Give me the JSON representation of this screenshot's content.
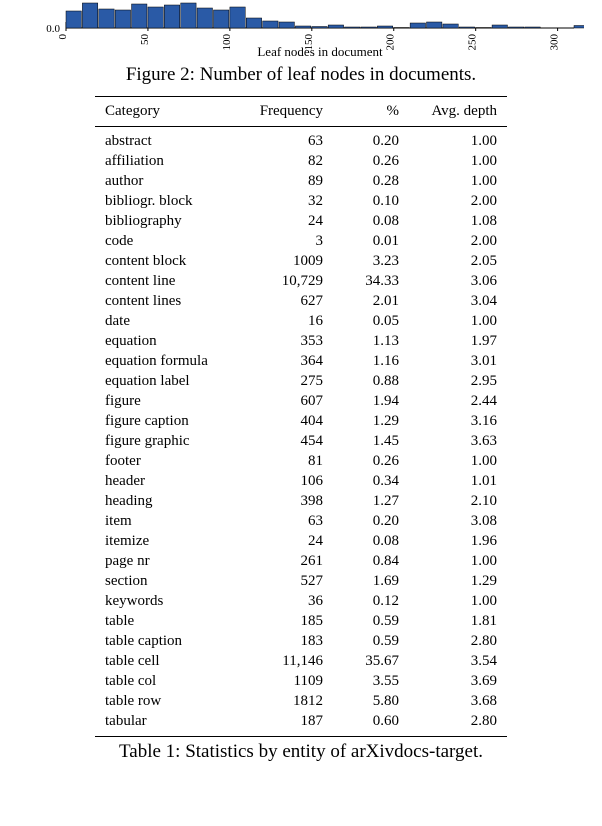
{
  "chart_data": {
    "type": "bar",
    "title": "",
    "xlabel": "Leaf nodes in document",
    "ylabel": "",
    "xlim": [
      0,
      310
    ],
    "ylim": [
      0.0,
      2.8
    ],
    "xticks": [
      0,
      50,
      100,
      150,
      200,
      250,
      300
    ],
    "yticks_visible": [
      0.0
    ],
    "bin_width": 10,
    "categories": [
      0,
      10,
      20,
      30,
      40,
      50,
      60,
      70,
      80,
      90,
      100,
      110,
      120,
      130,
      140,
      150,
      160,
      170,
      180,
      190,
      200,
      210,
      220,
      230,
      240,
      250,
      260,
      270,
      280,
      290,
      300,
      310
    ],
    "values": [
      1.7,
      2.5,
      1.9,
      1.8,
      2.4,
      2.1,
      2.3,
      2.5,
      2.0,
      1.8,
      2.1,
      1.0,
      0.7,
      0.6,
      0.2,
      0.15,
      0.3,
      0.1,
      0.1,
      0.2,
      0.05,
      0.5,
      0.6,
      0.4,
      0.1,
      0.05,
      0.3,
      0.1,
      0.1,
      0.0,
      0.0,
      0.25
    ],
    "bar_color": "#2a5aa6"
  },
  "figure_caption": "Figure 2: Number of leaf nodes in documents.",
  "table_caption": "Table 1: Statistics by entity of arXivdocs-target.",
  "table": {
    "headers": {
      "c0": "Category",
      "c1": "Frequency",
      "c2": "%",
      "c3": "Avg. depth"
    },
    "rows": [
      {
        "cat": "abstract",
        "freq": "63",
        "pct": "0.20",
        "dep": "1.00"
      },
      {
        "cat": "affiliation",
        "freq": "82",
        "pct": "0.26",
        "dep": "1.00"
      },
      {
        "cat": "author",
        "freq": "89",
        "pct": "0.28",
        "dep": "1.00"
      },
      {
        "cat": "bibliogr. block",
        "freq": "32",
        "pct": "0.10",
        "dep": "2.00"
      },
      {
        "cat": "bibliography",
        "freq": "24",
        "pct": "0.08",
        "dep": "1.08"
      },
      {
        "cat": "code",
        "freq": "3",
        "pct": "0.01",
        "dep": "2.00"
      },
      {
        "cat": "content block",
        "freq": "1009",
        "pct": "3.23",
        "dep": "2.05"
      },
      {
        "cat": "content line",
        "freq": "10,729",
        "pct": "34.33",
        "dep": "3.06"
      },
      {
        "cat": "content lines",
        "freq": "627",
        "pct": "2.01",
        "dep": "3.04"
      },
      {
        "cat": "date",
        "freq": "16",
        "pct": "0.05",
        "dep": "1.00"
      },
      {
        "cat": "equation",
        "freq": "353",
        "pct": "1.13",
        "dep": "1.97"
      },
      {
        "cat": "equation formula",
        "freq": "364",
        "pct": "1.16",
        "dep": "3.01"
      },
      {
        "cat": "equation label",
        "freq": "275",
        "pct": "0.88",
        "dep": "2.95"
      },
      {
        "cat": "figure",
        "freq": "607",
        "pct": "1.94",
        "dep": "2.44"
      },
      {
        "cat": "figure caption",
        "freq": "404",
        "pct": "1.29",
        "dep": "3.16"
      },
      {
        "cat": "figure graphic",
        "freq": "454",
        "pct": "1.45",
        "dep": "3.63"
      },
      {
        "cat": "footer",
        "freq": "81",
        "pct": "0.26",
        "dep": "1.00"
      },
      {
        "cat": "header",
        "freq": "106",
        "pct": "0.34",
        "dep": "1.01"
      },
      {
        "cat": "heading",
        "freq": "398",
        "pct": "1.27",
        "dep": "2.10"
      },
      {
        "cat": "item",
        "freq": "63",
        "pct": "0.20",
        "dep": "3.08"
      },
      {
        "cat": "itemize",
        "freq": "24",
        "pct": "0.08",
        "dep": "1.96"
      },
      {
        "cat": "page nr",
        "freq": "261",
        "pct": "0.84",
        "dep": "1.00"
      },
      {
        "cat": "section",
        "freq": "527",
        "pct": "1.69",
        "dep": "1.29"
      },
      {
        "cat": "keywords",
        "freq": "36",
        "pct": "0.12",
        "dep": "1.00"
      },
      {
        "cat": "table",
        "freq": "185",
        "pct": "0.59",
        "dep": "1.81"
      },
      {
        "cat": "table caption",
        "freq": "183",
        "pct": "0.59",
        "dep": "2.80"
      },
      {
        "cat": "table cell",
        "freq": "11,146",
        "pct": "35.67",
        "dep": "3.54"
      },
      {
        "cat": "table col",
        "freq": "1109",
        "pct": "3.55",
        "dep": "3.69"
      },
      {
        "cat": "table row",
        "freq": "1812",
        "pct": "5.80",
        "dep": "3.68"
      },
      {
        "cat": "tabular",
        "freq": "187",
        "pct": "0.60",
        "dep": "2.80"
      }
    ]
  }
}
